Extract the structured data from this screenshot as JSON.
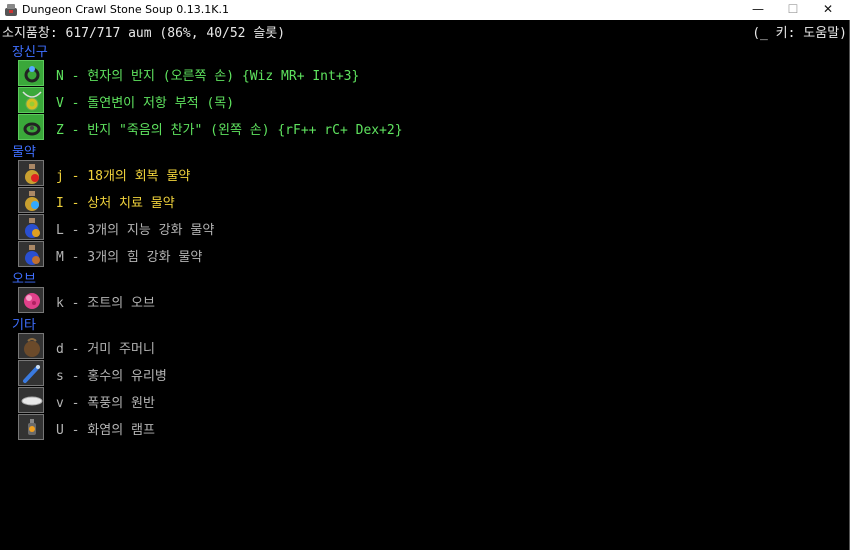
{
  "window": {
    "title": "Dungeon Crawl Stone Soup 0.13.1K.1",
    "minimize_glyph": "—",
    "maximize_glyph": "☐",
    "close_glyph": "✕"
  },
  "header": {
    "inventory_status": "소지품창: 617/717 aum (86%, 40/52 슬롯)",
    "help_hint": "(_ 키: 도움말)"
  },
  "sections": {
    "jewellery": "장신구",
    "potions": "물약",
    "orbs": "오브",
    "misc": "기타"
  },
  "items": {
    "N": {
      "text": "N - 현자의 반지 (오른쪽 손) {Wiz MR+ Int+3}",
      "icon": "ring-icon",
      "color": "#5fe35f"
    },
    "V": {
      "text": "V - 돌연변이 저항 부적 (목)",
      "icon": "amulet-icon",
      "color": "#5fe35f"
    },
    "Z": {
      "text": "Z - 반지 \"죽음의 찬가\" (왼쪽 손) {rF++ rC+ Dex+2}",
      "icon": "ring-icon",
      "color": "#5fe35f"
    },
    "j": {
      "text": "j - 18개의 회복 물약",
      "icon": "potion-icon",
      "color": "#f0d23c"
    },
    "I": {
      "text": "I - 상처 치료 물약",
      "icon": "potion-icon",
      "color": "#f0d23c"
    },
    "L": {
      "text": "L - 3개의 지능 강화 물약",
      "icon": "potion-icon",
      "color": "#b4b4b4"
    },
    "M": {
      "text": "M - 3개의 힘 강화 물약",
      "icon": "potion-icon",
      "color": "#b4b4b4"
    },
    "k": {
      "text": "k - 조트의 오브",
      "icon": "orb-icon",
      "color": "#b4b4b4"
    },
    "d": {
      "text": "d - 거미 주머니",
      "icon": "bag-icon",
      "color": "#b4b4b4"
    },
    "s": {
      "text": "s - 홍수의 유리병",
      "icon": "phial-icon",
      "color": "#b4b4b4"
    },
    "v": {
      "text": "v - 폭풍의 원반",
      "icon": "disc-icon",
      "color": "#b4b4b4"
    },
    "U": {
      "text": "U - 화염의 램프",
      "icon": "lamp-icon",
      "color": "#b4b4b4"
    }
  }
}
